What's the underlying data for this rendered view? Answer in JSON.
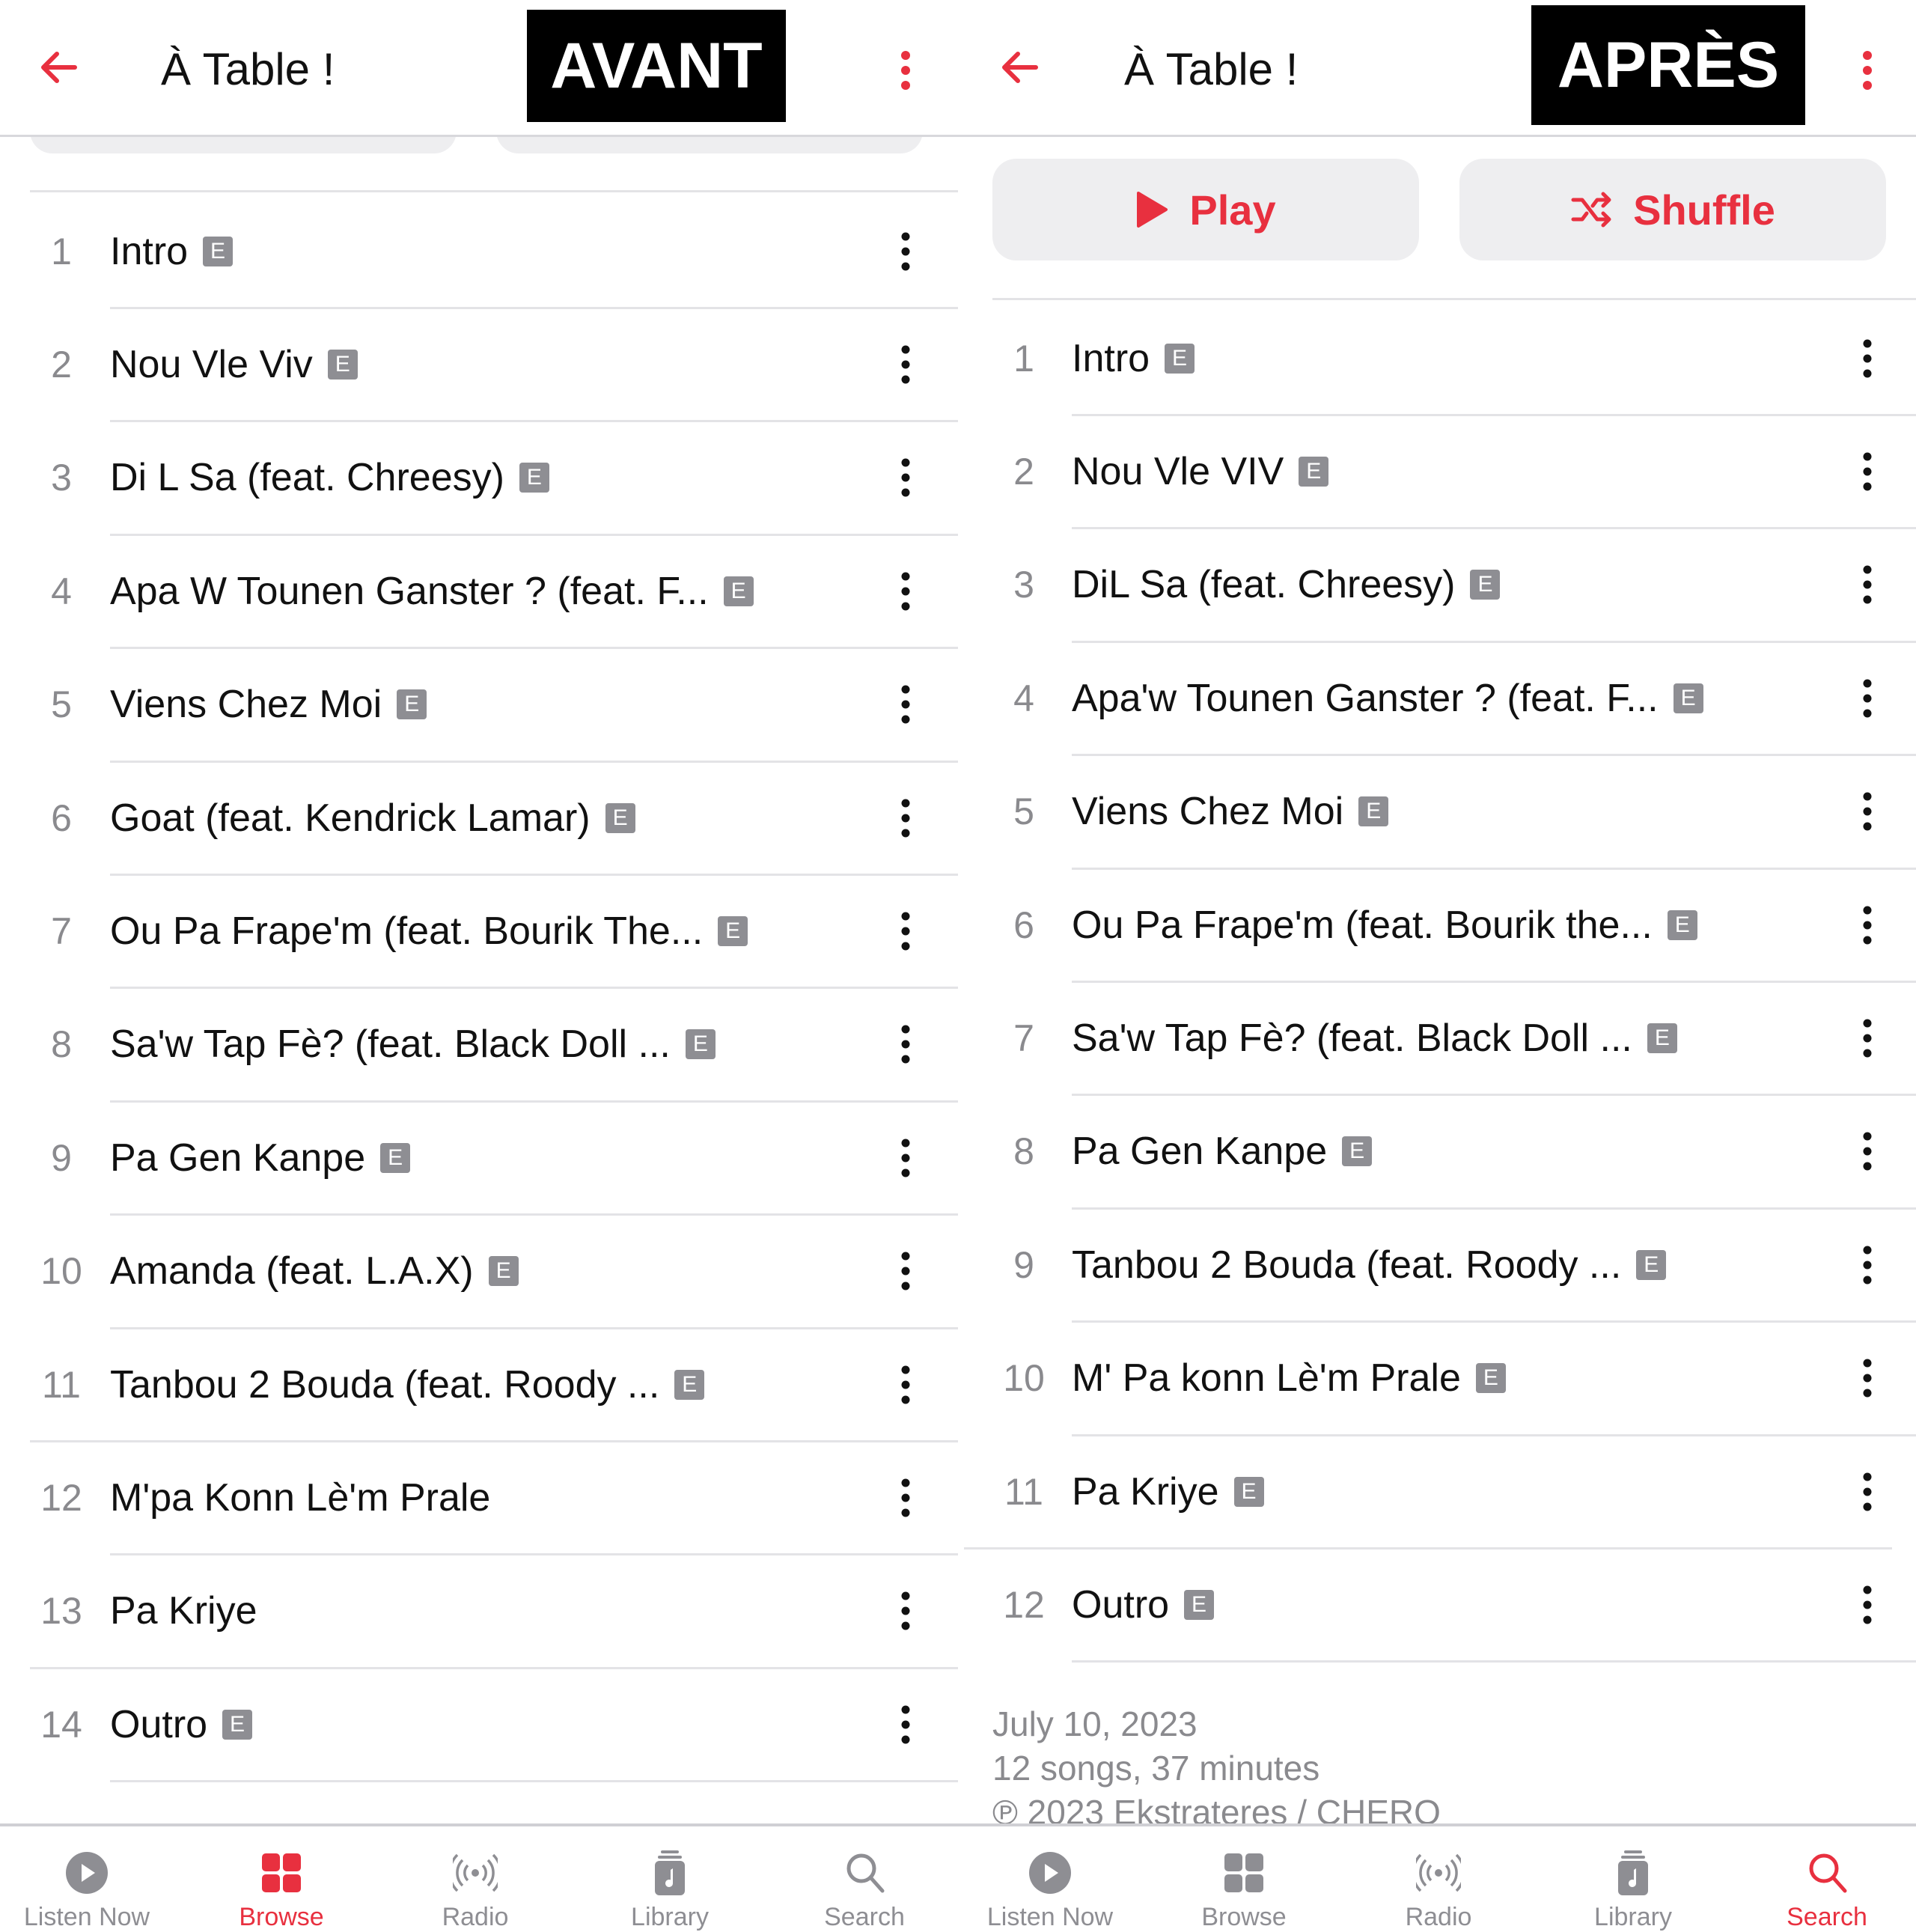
{
  "colors": {
    "accent": "#e8303f",
    "gray": "#8e8e93"
  },
  "left": {
    "label": "AVANT",
    "header": {
      "title": "À Table !",
      "back_icon": "arrow-left-icon",
      "more_icon": "ellipsis-vertical-icon"
    },
    "tracks": [
      {
        "n": "1",
        "title": "Intro",
        "explicit": true
      },
      {
        "n": "2",
        "title": "Nou Vle Viv",
        "explicit": true
      },
      {
        "n": "3",
        "title": "Di L Sa (feat. Chreesy)",
        "explicit": true
      },
      {
        "n": "4",
        "title": "Apa W Tounen Ganster ? (feat. F...",
        "explicit": true
      },
      {
        "n": "5",
        "title": "Viens Chez Moi",
        "explicit": true
      },
      {
        "n": "6",
        "title": "Goat (feat. Kendrick Lamar)",
        "explicit": true
      },
      {
        "n": "7",
        "title": "Ou Pa Frape'm (feat. Bourik The...",
        "explicit": true
      },
      {
        "n": "8",
        "title": "Sa'w Tap Fè? (feat. Black Doll ...",
        "explicit": true
      },
      {
        "n": "9",
        "title": "Pa Gen Kanpe",
        "explicit": true
      },
      {
        "n": "10",
        "title": "Amanda (feat. L.A.X)",
        "explicit": true
      },
      {
        "n": "11",
        "title": "Tanbou 2 Bouda (feat. Roody ...",
        "explicit": true
      },
      {
        "n": "12",
        "title": "M'pa Konn Lè'm Prale",
        "explicit": false
      },
      {
        "n": "13",
        "title": "Pa Kriye",
        "explicit": false
      },
      {
        "n": "14",
        "title": "Outro",
        "explicit": true
      }
    ],
    "tabs": [
      {
        "label": "Listen Now",
        "icon": "play-circle-icon",
        "active": false
      },
      {
        "label": "Browse",
        "icon": "grid-icon",
        "active": true
      },
      {
        "label": "Radio",
        "icon": "radio-waves-icon",
        "active": false
      },
      {
        "label": "Library",
        "icon": "music-library-icon",
        "active": false
      },
      {
        "label": "Search",
        "icon": "search-icon",
        "active": false
      }
    ]
  },
  "right": {
    "label": "APRÈS",
    "header": {
      "title": "À Table !",
      "back_icon": "arrow-left-icon",
      "more_icon": "ellipsis-vertical-icon"
    },
    "play_label": "Play",
    "shuffle_label": "Shuffle",
    "tracks": [
      {
        "n": "1",
        "title": "Intro",
        "explicit": true
      },
      {
        "n": "2",
        "title": "Nou Vle VIV",
        "explicit": true
      },
      {
        "n": "3",
        "title": "DiL Sa (feat. Chreesy)",
        "explicit": true
      },
      {
        "n": "4",
        "title": "Apa'w Tounen Ganster ? (feat. F...",
        "explicit": true
      },
      {
        "n": "5",
        "title": "Viens Chez Moi",
        "explicit": true
      },
      {
        "n": "6",
        "title": "Ou Pa Frape'm (feat. Bourik the...",
        "explicit": true
      },
      {
        "n": "7",
        "title": "Sa'w Tap Fè? (feat. Black Doll ...",
        "explicit": true
      },
      {
        "n": "8",
        "title": "Pa Gen Kanpe",
        "explicit": true
      },
      {
        "n": "9",
        "title": "Tanbou 2 Bouda (feat. Roody ...",
        "explicit": true
      },
      {
        "n": "10",
        "title": "M' Pa konn Lè'm Prale",
        "explicit": true
      },
      {
        "n": "11",
        "title": "Pa Kriye",
        "explicit": true
      },
      {
        "n": "12",
        "title": "Outro",
        "explicit": true
      }
    ],
    "footer": {
      "date": "July 10, 2023",
      "summary": "12 songs, 37 minutes",
      "copyright": "℗ 2023 Ekstrateres / CHERO"
    },
    "tabs": [
      {
        "label": "Listen Now",
        "icon": "play-circle-icon",
        "active": false
      },
      {
        "label": "Browse",
        "icon": "grid-icon",
        "active": false
      },
      {
        "label": "Radio",
        "icon": "radio-waves-icon",
        "active": false
      },
      {
        "label": "Library",
        "icon": "music-library-icon",
        "active": false
      },
      {
        "label": "Search",
        "icon": "search-icon",
        "active": true
      }
    ],
    "explicit_badge": "E"
  }
}
